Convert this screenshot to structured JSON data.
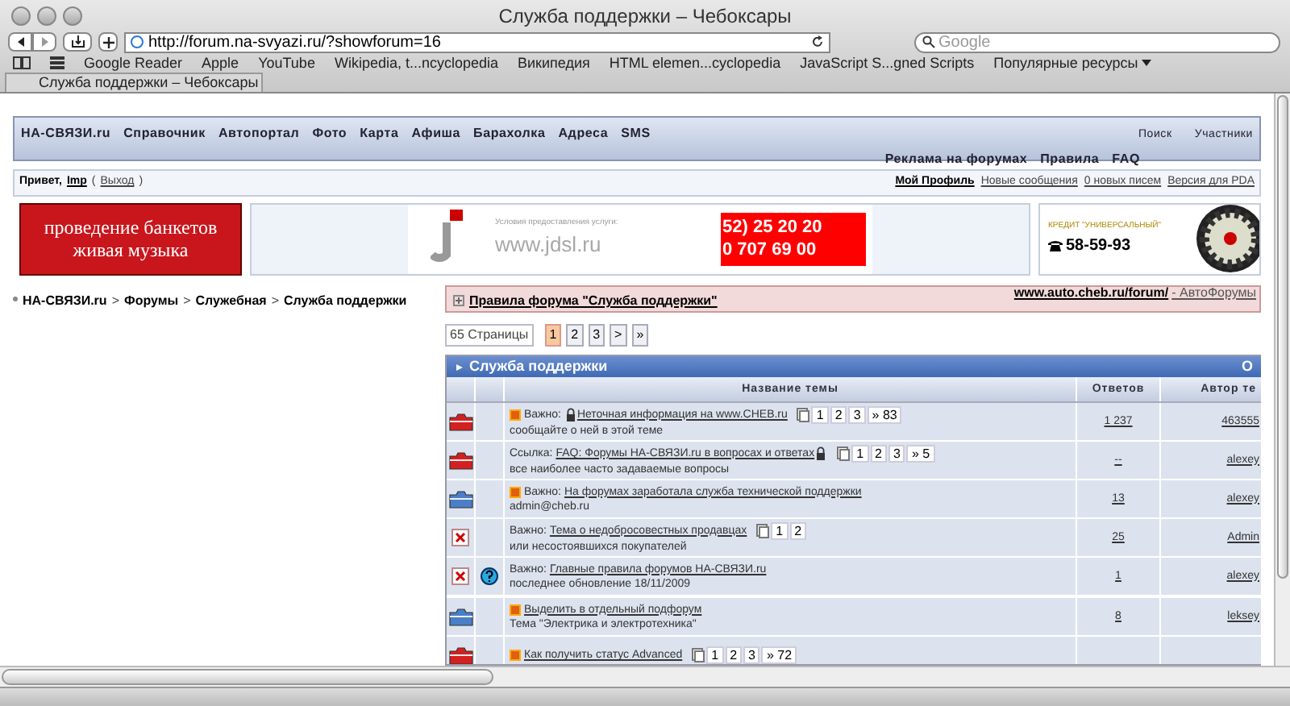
{
  "browser": {
    "title": "Служба поддержки – Чебоксары",
    "url": "http://forum.na-svyazi.ru/?showforum=16",
    "search_placeholder": "Google",
    "bookmarks": [
      {
        "label": "Google Reader",
        "menu": false
      },
      {
        "label": "Apple",
        "menu": false
      },
      {
        "label": "YouTube",
        "menu": false
      },
      {
        "label": "Wikipedia, t...ncyclopedia",
        "menu": false
      },
      {
        "label": "Википедия",
        "menu": false
      },
      {
        "label": "HTML elemen...cyclopedia",
        "menu": false
      },
      {
        "label": "JavaScript S...gned Scripts",
        "menu": false
      },
      {
        "label": "Популярные ресурсы",
        "menu": true
      }
    ],
    "tab": "Служба поддержки – Чебоксары"
  },
  "site_nav": {
    "items": [
      "НА-СВЯЗИ.ru",
      "Справочник",
      "Автопортал",
      "Фото",
      "Карта",
      "Афиша",
      "Барахолка",
      "Адреса",
      "SMS"
    ],
    "right_top": [
      "Поиск",
      "Участники"
    ],
    "right_bottom": [
      "Реклама на форумах",
      "Правила",
      "FAQ"
    ]
  },
  "user_bar": {
    "greeting": "Привет,",
    "username": "Imp",
    "open_bracket": "(",
    "logout": "Выход",
    "close_bracket": ")",
    "links": [
      {
        "label": "Мой Профиль",
        "bold": true
      },
      {
        "label": "Новые сообщения",
        "bold": false
      },
      {
        "label": "0 новых писем",
        "bold": false
      },
      {
        "label": "Версия для PDA",
        "bold": false
      }
    ]
  },
  "banners": {
    "left": [
      "проведение банкетов",
      "живая музыка"
    ],
    "middle_caption": "Условия предоставления услуги:",
    "middle_site": "www.jdsl.ru",
    "middle_phones": [
      "52) 25 20 20",
      "0 707 69 00"
    ],
    "right_caption": "КРЕДИТ \"УНИВЕРСАЛЬНЫЙ\"",
    "right_phone": "58-59-93"
  },
  "breadcrumb": {
    "items": [
      "НА-СВЯЗИ.ru",
      "Форумы",
      "Служебная",
      "Служба поддержки"
    ],
    "separator": ">"
  },
  "rules": {
    "label": "Правила форума \"Служба поддержки\"",
    "ad_link": "www.auto.cheb.ru/forum/",
    "ad_text": "- АвтоФорумы"
  },
  "pagination": {
    "label": "65 Страницы",
    "items": [
      {
        "label": "1",
        "selected": true
      },
      {
        "label": "2",
        "selected": false
      },
      {
        "label": "3",
        "selected": false
      },
      {
        "label": ">",
        "selected": false
      },
      {
        "label": "»",
        "selected": false
      }
    ]
  },
  "forum": {
    "title": "Служба поддержки",
    "title_right": "О",
    "columns": [
      "Название темы",
      "Ответов",
      "Автор те"
    ],
    "topics": [
      {
        "kind": "topic",
        "status_icon": {
          "kind": "hot"
        },
        "pinned_flag": true,
        "lock": {
          "kind": "before"
        },
        "prefix": "Важно:",
        "title": "Неточная информация на www.CHEB.ru",
        "pages": [
          "1",
          "2",
          "3",
          "» 83"
        ],
        "description": "сообщайте о ней в этой теме",
        "replies": "1 237",
        "author": "463555"
      },
      {
        "kind": "topic",
        "status_icon": {
          "kind": "hot"
        },
        "pinned_flag": false,
        "lock": {
          "kind": "after"
        },
        "prefix": "Ссылка:",
        "title": "FAQ: Форумы НА-СВЯЗИ.ru в вопросах и ответах",
        "pages": [
          "1",
          "2",
          "3",
          "» 5"
        ],
        "description": "все наиболее часто задаваемые вопросы",
        "replies": "--",
        "author": "alexey"
      },
      {
        "kind": "topic",
        "status_icon": {
          "kind": "normal"
        },
        "pinned_flag": true,
        "prefix": "Важно:",
        "title": "На форумах заработала служба технической поддержки",
        "description": "admin@cheb.ru",
        "replies": "13",
        "author": "alexey"
      },
      {
        "kind": "topic",
        "status_icon": {
          "kind": "moved"
        },
        "pinned_flag": false,
        "prefix": "Важно:",
        "title": "Тема о недобросовестных продавцах",
        "pages": [
          "1",
          "2"
        ],
        "description": "или несостоявшихся покупателей",
        "replies": "25",
        "author": "Admin"
      },
      {
        "kind": "topic",
        "status_icon": {
          "kind": "moved"
        },
        "extra_icon": {
          "kind": "question"
        },
        "pinned_flag": false,
        "prefix": "Важно:",
        "title": "Главные правила форумов НА-СВЯЗИ.ru",
        "description": "последнее обновление 18/11/2009",
        "replies": "1",
        "author": "alexey"
      },
      {
        "kind": "divider"
      },
      {
        "kind": "topic",
        "status_icon": {
          "kind": "normal"
        },
        "pinned_flag": true,
        "title": "Выделить в отдельный подфорум",
        "description": "Тема \"Электрика и электротехника\"",
        "replies": "8",
        "author": "leksey"
      },
      {
        "kind": "topic",
        "status_icon": {
          "kind": "hot"
        },
        "pinned_flag": true,
        "title": "Как получить статус Advanced",
        "pages": [
          "1",
          "2",
          "3",
          "» 72"
        ]
      }
    ]
  }
}
